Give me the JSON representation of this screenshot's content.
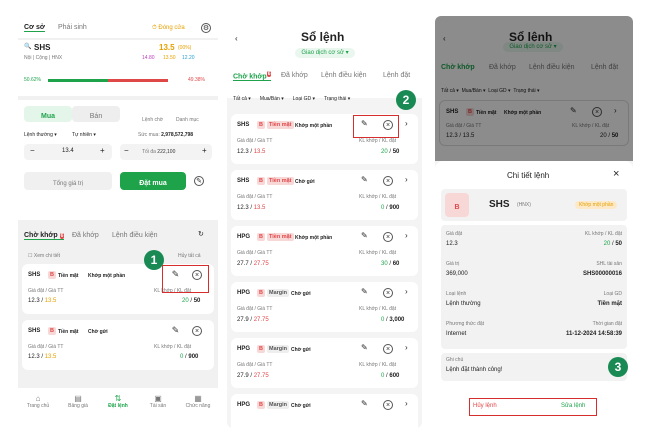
{
  "s1": {
    "tabs": [
      "Cơ sở",
      "Phái sinh"
    ],
    "market_status": "Đóng cửa",
    "symbol": "SHS",
    "price": "13.5",
    "change": "(00%)",
    "exchange_tags": [
      "Nội",
      "Cộng",
      "HNX"
    ],
    "ceil_ref_floor": [
      "14.80",
      "13.50",
      "12.20"
    ],
    "ratio_left": "50.62%",
    "ratio_right": "49.38%",
    "side_buy": "Mua",
    "side_sell": "Bán",
    "order_book": "Lệnh chờ",
    "watchlist": "Danh mục",
    "order_type": "Lệnh thường",
    "price_type": "Tự nhiên",
    "buying_power_label": "Sức mua",
    "buying_power": "2,978,572,798",
    "qty_price": "13.4",
    "max_label": "Tối đa",
    "max_qty": "222,100",
    "total_label": "Tổng giá trị",
    "buy_btn": "Đặt mua",
    "order_tabs": [
      "Chờ khớp",
      "Đã khớp",
      "Lệnh điều kiện"
    ],
    "pending_count": "6",
    "view_detail": "Xem chi tiết",
    "cancel_all": "Hủy tất cả",
    "orders": [
      {
        "symbol": "SHS",
        "side": "B",
        "acct": "Tiền mặt",
        "status": "Khớp một phần",
        "price_label": "Giá đặt / Giá TT",
        "qty_label": "KL khớp / KL đặt",
        "price": "12.3",
        "mkt": "13.5",
        "matched": "20",
        "qty": "50"
      },
      {
        "symbol": "SHS",
        "side": "B",
        "acct": "Tiền mặt",
        "status": "Chờ gửi",
        "price_label": "Giá đặt / Giá TT",
        "qty_label": "KL khớp / KL đặt",
        "price": "12.3",
        "mkt": "13.5",
        "matched": "0",
        "qty": "900"
      }
    ],
    "nav": [
      "Trang chủ",
      "Bảng giá",
      "Đặt lệnh",
      "Tài sản",
      "Chức năng"
    ]
  },
  "s2": {
    "title": "Sổ lệnh",
    "subtitle": "Giao dịch cơ sở",
    "tabs": [
      "Chờ khớp",
      "Đã khớp",
      "Lệnh điều kiện",
      "Lệnh đặt"
    ],
    "pending_count": "6",
    "filters": [
      "Tất cả",
      "Mua/Bán",
      "Loại GD",
      "Trạng thái"
    ],
    "price_label": "Giá đặt / Giá TT",
    "qty_label": "KL khớp / KL đặt",
    "orders": [
      {
        "symbol": "SHS",
        "side": "B",
        "acct": "Tiền mặt",
        "status": "Khớp một phần",
        "price": "12.3",
        "mkt": "13.5",
        "matched": "20",
        "qty": "50"
      },
      {
        "symbol": "SHS",
        "side": "B",
        "acct": "Tiền mặt",
        "status": "Chờ gửi",
        "price": "12.3",
        "mkt": "13.5",
        "matched": "0",
        "qty": "900"
      },
      {
        "symbol": "HPG",
        "side": "B",
        "acct": "Tiền mặt",
        "status": "Khớp một phần",
        "price": "27.7",
        "mkt": "27.75",
        "matched": "30",
        "qty": "60"
      },
      {
        "symbol": "HPG",
        "side": "B",
        "acct": "Margin",
        "status": "Chờ gửi",
        "price": "27.9",
        "mkt": "27.75",
        "matched": "0",
        "qty": "3,000"
      },
      {
        "symbol": "HPG",
        "side": "B",
        "acct": "Margin",
        "status": "Chờ gửi",
        "price": "27.9",
        "mkt": "27.75",
        "matched": "0",
        "qty": "600"
      },
      {
        "symbol": "HPG",
        "side": "B",
        "acct": "Margin",
        "status": "Chờ gửi",
        "price": "",
        "mkt": "",
        "matched": "",
        "qty": ""
      }
    ]
  },
  "s3": {
    "sheet_title": "Chi tiết lệnh",
    "side": "B",
    "symbol": "SHS",
    "exchange": "(HNX)",
    "status": "Khớp một phần",
    "fields": [
      {
        "l1": "Giá đặt",
        "v1": "12.3",
        "l2": "KL khớp / KL đặt",
        "v2a": "20",
        "v2b": "50"
      },
      {
        "l1": "Giá trị",
        "v1": "369,000",
        "l2": "SHL tài sản",
        "v2a": "",
        "v2b": "SHS00000016"
      },
      {
        "l1": "Loại lệnh",
        "v1": "Lệnh thường",
        "l2": "Loại GD",
        "v2a": "",
        "v2b": "Tiền mặt"
      },
      {
        "l1": "Phương thức đặt",
        "v1": "Internet",
        "l2": "Thời gian đặt",
        "v2a": "",
        "v2b": "11-12-2024 14:58:39"
      }
    ],
    "note_label": "Ghi chú",
    "note": "Lệnh đặt thành công!",
    "cancel_btn": "Hủy lệnh",
    "edit_btn": "Sửa lệnh"
  },
  "steps": [
    "1",
    "2",
    "3"
  ],
  "colors": {
    "accent": "#1ea34b",
    "danger": "#e04848",
    "highlight": "#d62d2d",
    "step": "#1a8a55"
  }
}
